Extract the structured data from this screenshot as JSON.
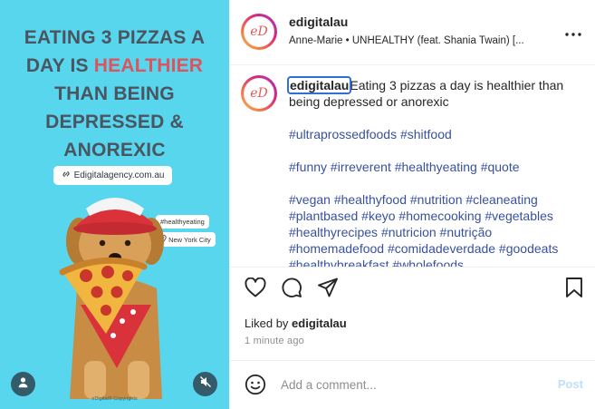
{
  "media": {
    "headline_line1": "EATING 3 PIZZAS A",
    "headline_line2_a": "DAY IS ",
    "headline_line2_highlight": "HEALTHIER",
    "headline_line3": "THAN BEING",
    "headline_line4": "DEPRESSED &",
    "headline_line5": "ANOREXIC",
    "site_badge": "Edigitalagency.com.au",
    "tag_hashtag": "#healthyeating",
    "tag_location": "New York City",
    "copyright": "eDigital® Copyrights",
    "icons": {
      "user": "user-icon",
      "mute": "speaker-muted-icon"
    },
    "colors": {
      "background": "#57d6ee",
      "headline": "#4a5560",
      "highlight": "#e0525c"
    }
  },
  "header": {
    "avatar_text": "eD",
    "username": "edigitalau",
    "audio": "Anne-Marie • UNHEALTHY (feat. Shania Twain) [...",
    "more_icon": "more-horizontal-icon"
  },
  "caption": {
    "username": "edigitalau",
    "text_line": "Eating 3 pizzas a day is healthier than being depressed or anorexic",
    "hashtags_1": "#ultraprossedfoods #shitfood",
    "hashtags_2": "#funny #irreverent #healthyeating #quote",
    "hashtags_3": "#vegan #healthyfood #nutrition #cleaneating #plantbased #keyo #homecooking #vegetables #healthyrecipes #nutricion #nutrição #homemadefood #comidadeverdade #goodeats #healthybreakfast #wholefoods"
  },
  "actions": {
    "like_icon": "heart-icon",
    "comment_icon": "comment-icon",
    "share_icon": "send-icon",
    "save_icon": "bookmark-icon"
  },
  "likes": {
    "prefix": "Liked by ",
    "user": "edigitalau",
    "time": "1 minute ago"
  },
  "comment": {
    "emoji_icon": "emoji-icon",
    "placeholder": "Add a comment...",
    "post_label": "Post"
  }
}
